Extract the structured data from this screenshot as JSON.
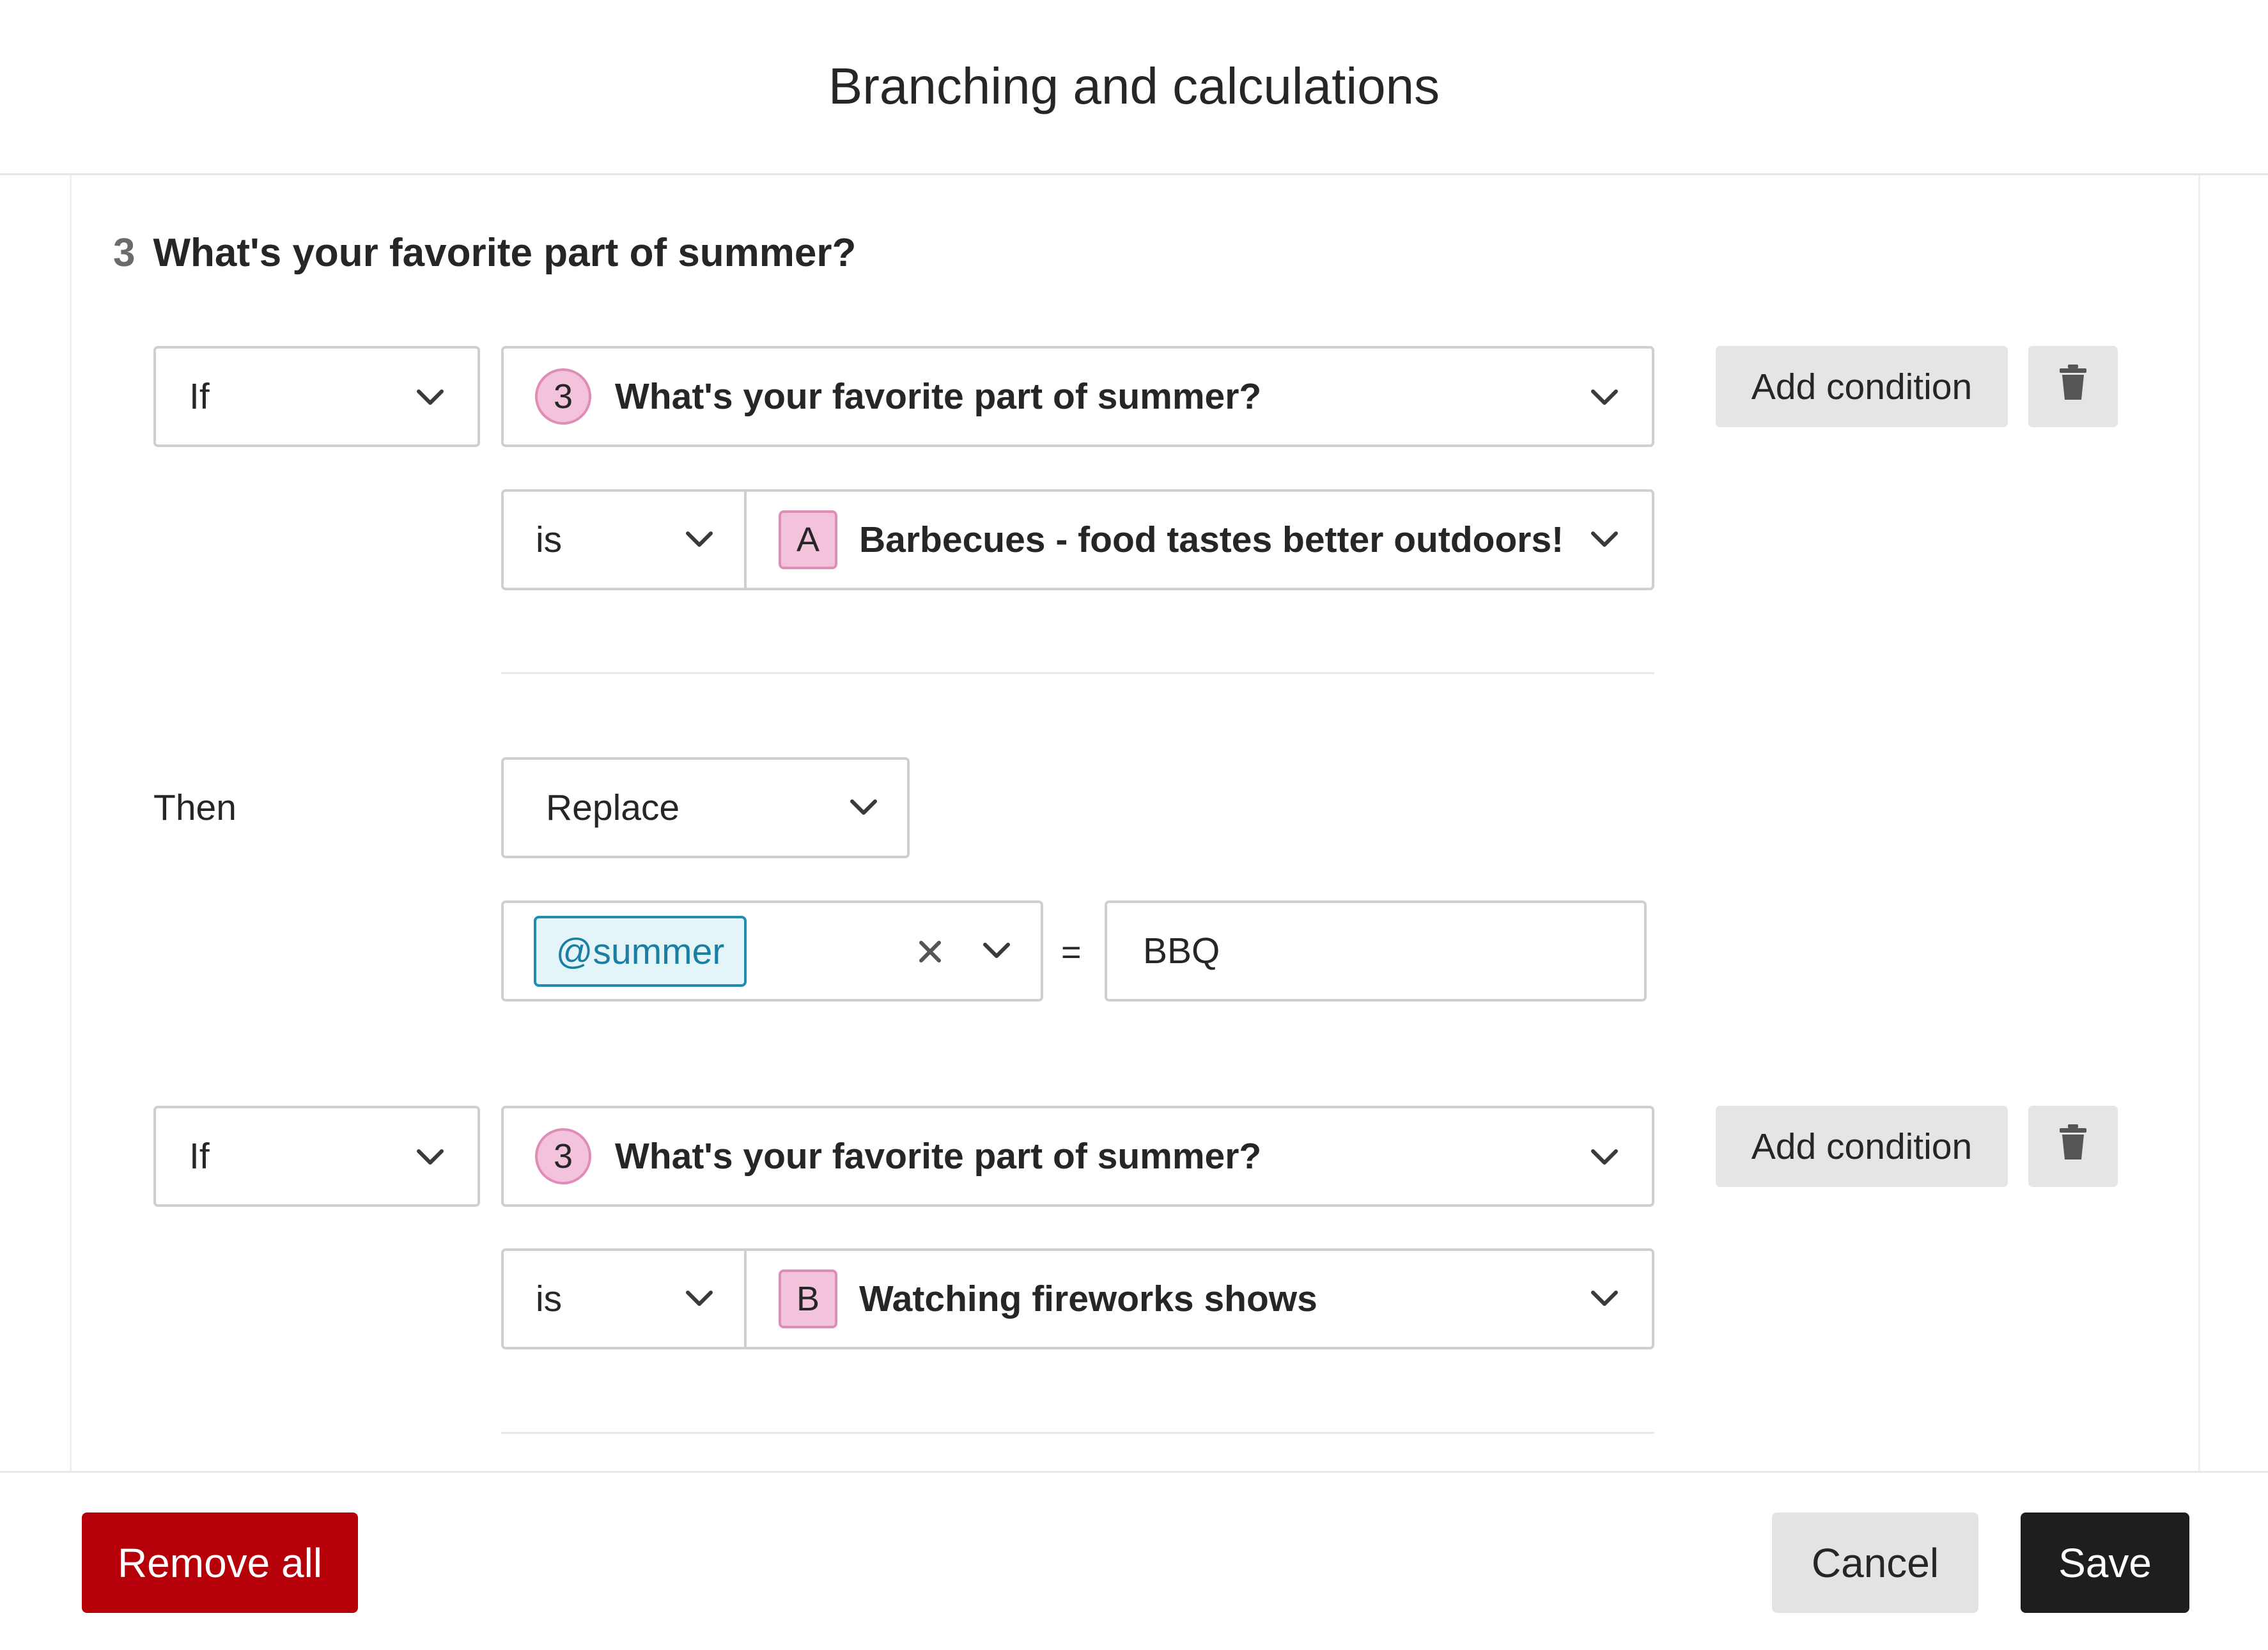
{
  "header": {
    "title": "Branching and calculations"
  },
  "question": {
    "number": "3",
    "title": "What's your favorite part of summer?"
  },
  "rules": [
    {
      "if_label": "If",
      "question_badge": "3",
      "question_text": "What's your favorite part of summer?",
      "operator": "is",
      "answer_letter": "A",
      "answer_text": "Barbecues - food tastes better outdoors!",
      "add_condition_label": "Add condition"
    },
    {
      "if_label": "If",
      "question_badge": "3",
      "question_text": "What's your favorite part of summer?",
      "operator": "is",
      "answer_letter": "B",
      "answer_text": "Watching fireworks shows",
      "add_condition_label": "Add condition"
    }
  ],
  "action": {
    "then_label": "Then",
    "action_type": "Replace",
    "variable_tag": "@summer",
    "equals": "=",
    "value": "BBQ"
  },
  "footer": {
    "remove_all_label": "Remove all",
    "cancel_label": "Cancel",
    "save_label": "Save"
  },
  "colors": {
    "remove_button": "#b5000a",
    "save_button": "#1e1e1e",
    "badge_fill": "#f3c2db",
    "tag_border": "#1f8db0"
  }
}
